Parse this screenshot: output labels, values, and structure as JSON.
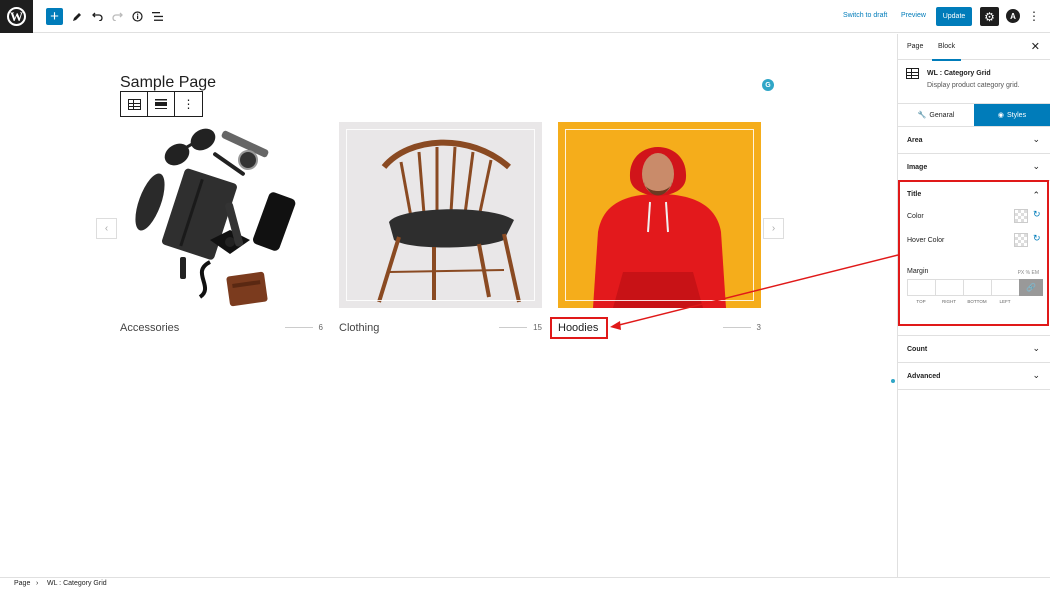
{
  "topbar": {
    "wp_logo": "W",
    "plus": "+",
    "switch_draft": "Switch to draft",
    "preview": "Preview",
    "update": "Update",
    "icons": [
      "wordpress-logo-icon",
      "plus-icon",
      "pencil-icon",
      "undo-icon",
      "redo-icon",
      "info-icon",
      "list-view-icon",
      "gear-icon",
      "astra-icon",
      "kebab-icon"
    ]
  },
  "canvas": {
    "page_title": "Sample Page",
    "prev_arrow": "‹",
    "next_arrow": "›",
    "categories": [
      {
        "name": "Accessories",
        "count": "6"
      },
      {
        "name": "Clothing",
        "count": "15"
      },
      {
        "name": "Hoodies",
        "count": "3"
      }
    ]
  },
  "sidebar": {
    "tab_page": "Page",
    "tab_block": "Block",
    "close": "✕",
    "block_name": "WL : Category Grid",
    "block_desc": "Display product category grid.",
    "subtab_general": "Genaral",
    "subtab_styles": "Styles",
    "panels": {
      "area": "Area",
      "image": "Image",
      "title": "Title",
      "count": "Count",
      "advanced": "Advanced"
    },
    "title_panel": {
      "color_label": "Color",
      "hover_color_label": "Hover Color",
      "margin_label": "Margin",
      "units": "PX  %  EM",
      "margin_sides": [
        "TOP",
        "RIGHT",
        "BOTTOM",
        "LEFT"
      ]
    }
  },
  "statusbar": {
    "crumb_page": "Page",
    "crumb_sep": "›",
    "crumb_block": "WL : Category Grid"
  },
  "colors": {
    "accent": "#007cba",
    "highlight": "#e01919",
    "hoodie_bg": "#f5ad1b",
    "hoodie": "#e3191c"
  }
}
